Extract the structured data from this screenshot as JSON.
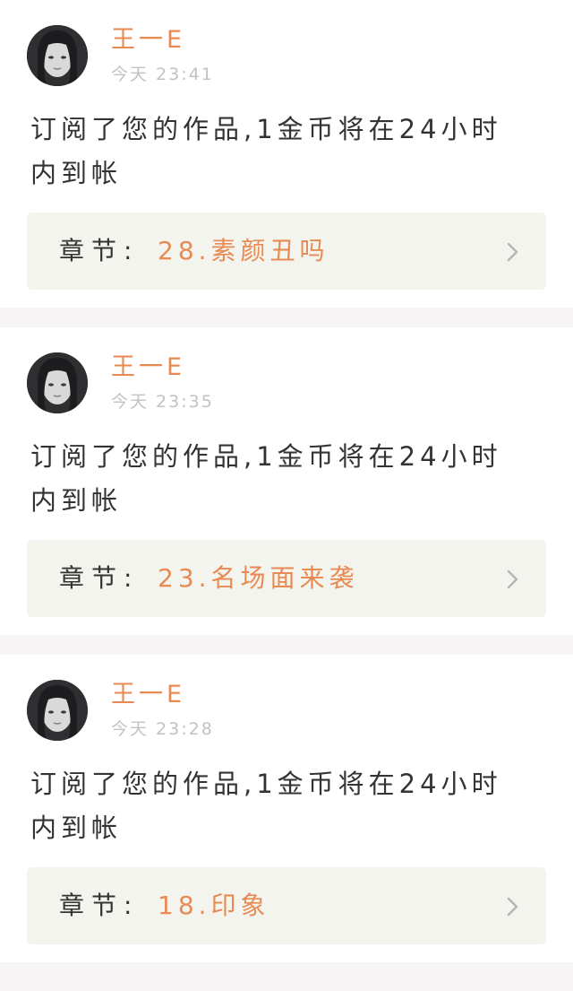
{
  "notifications": [
    {
      "user": "王一E",
      "time": "今天 23:41",
      "message": "订阅了您的作品,1金币将在24小时内到帐",
      "chapter_label": "章节:",
      "chapter_title": "28.素颜丑吗"
    },
    {
      "user": "王一E",
      "time": "今天 23:35",
      "message": "订阅了您的作品,1金币将在24小时内到帐",
      "chapter_label": "章节:",
      "chapter_title": "23.名场面来袭"
    },
    {
      "user": "王一E",
      "time": "今天 23:28",
      "message": "订阅了您的作品,1金币将在24小时内到帐",
      "chapter_label": "章节:",
      "chapter_title": "18.印象"
    }
  ],
  "colors": {
    "accent": "#e88a52",
    "text": "#333333",
    "muted": "#c2c2c2",
    "chapter_bg": "#f4f4ee",
    "separator": "#f7f4f5"
  },
  "icons": {
    "chevron": "chevron-right-icon",
    "avatar": "avatar"
  }
}
